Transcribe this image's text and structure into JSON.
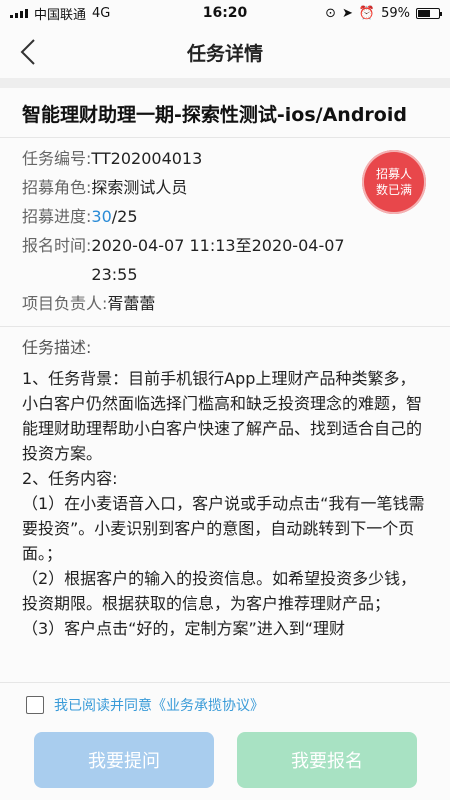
{
  "status_bar": {
    "carrier": "中国联通",
    "network": "4G",
    "time": "16:20",
    "battery": "59%",
    "battery_level": 0.59
  },
  "nav": {
    "title": "任务详情"
  },
  "task": {
    "title": "智能理财助理一期-探索性测试-ios/Android",
    "number_label": "任务编号:",
    "number": "TT202004013",
    "role_label": "招募角色:",
    "role": "探索测试人员",
    "progress_label": "招募进度:",
    "progress_current": "30",
    "progress_total": "/25",
    "time_label": "报名时间:",
    "time_line1": "2020-04-07 11:13至2020-04-07",
    "time_line2": "23:55",
    "owner_label": "项目负责人:",
    "owner": "胥蕾蕾",
    "stamp_line1": "招募人",
    "stamp_line2": "数已满"
  },
  "description": {
    "heading": "任务描述:",
    "p1": "1、任务背景：目前手机银行App上理财产品种类繁多，小白客户仍然面临选择门槛高和缺乏投资理念的难题，智能理财助理帮助小白客户快速了解产品、找到适合自己的投资方案。",
    "p2": "2、任务内容:",
    "p3": "（1）在小麦语音入口，客户说或手动点击“我有一笔钱需要投资”。小麦识别到客户的意图，自动跳转到下一个页面。；",
    "p4": "（2）根据客户的输入的投资信息。如希望投资多少钱，投资期限。根据获取的信息，为客户推荐理财产品；",
    "p5": "（3）客户点击“好的，定制方案”进入到“理财"
  },
  "agreement": {
    "text": "我已阅读并同意《业务承揽协议》"
  },
  "buttons": {
    "ask": "我要提问",
    "signup": "我要报名"
  },
  "colors": {
    "accent": "#2a8bd6",
    "stamp": "#e8474b",
    "ask_button": "#a9cdee",
    "signup_button": "#a8e2c3"
  }
}
